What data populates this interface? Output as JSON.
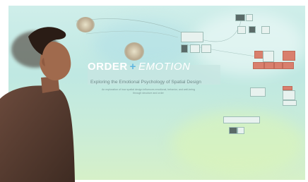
{
  "slide": {
    "title_part1": "ORDER",
    "title_plus": "+",
    "title_part2": "EMOTION",
    "subtitle": "Exploring the Emotional Psychology of Spatial Design",
    "description": "An exploration of how spatial design influences emotional, behavior, and well-being through structure and order"
  }
}
